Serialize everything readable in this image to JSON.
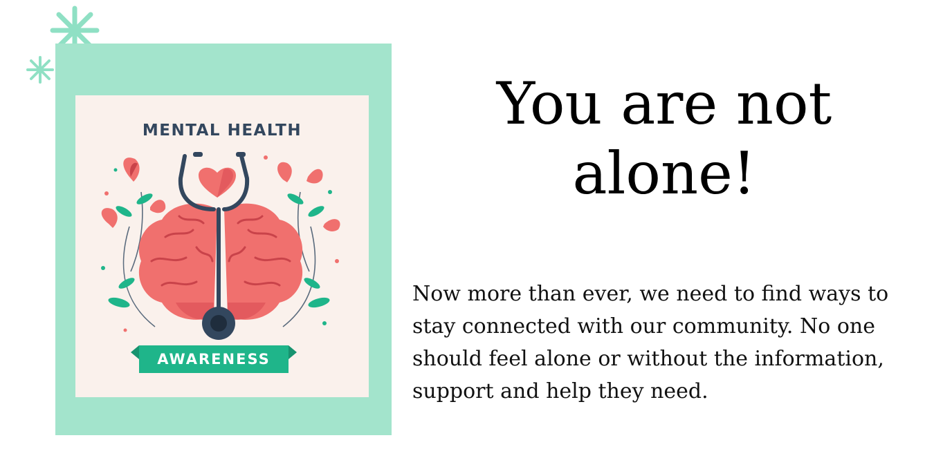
{
  "graphic": {
    "title": "MENTAL HEALTH",
    "ribbon_label": "AWARENESS"
  },
  "headline": "You are not alone!",
  "body": "Now more than ever, we need to find ways to stay connected with our community. No one should feel alone or without the information, support and help they need.",
  "colors": {
    "mint": "#a3e4cc",
    "card": "#faf1ec",
    "brain": "#f0706e",
    "ribbon": "#1fb58a",
    "navy": "#33475e",
    "sparkle": "#8fe0c4"
  },
  "icons": [
    "sparkle-icon",
    "brain-icon",
    "stethoscope-icon",
    "heart-icon",
    "flower-icon"
  ]
}
